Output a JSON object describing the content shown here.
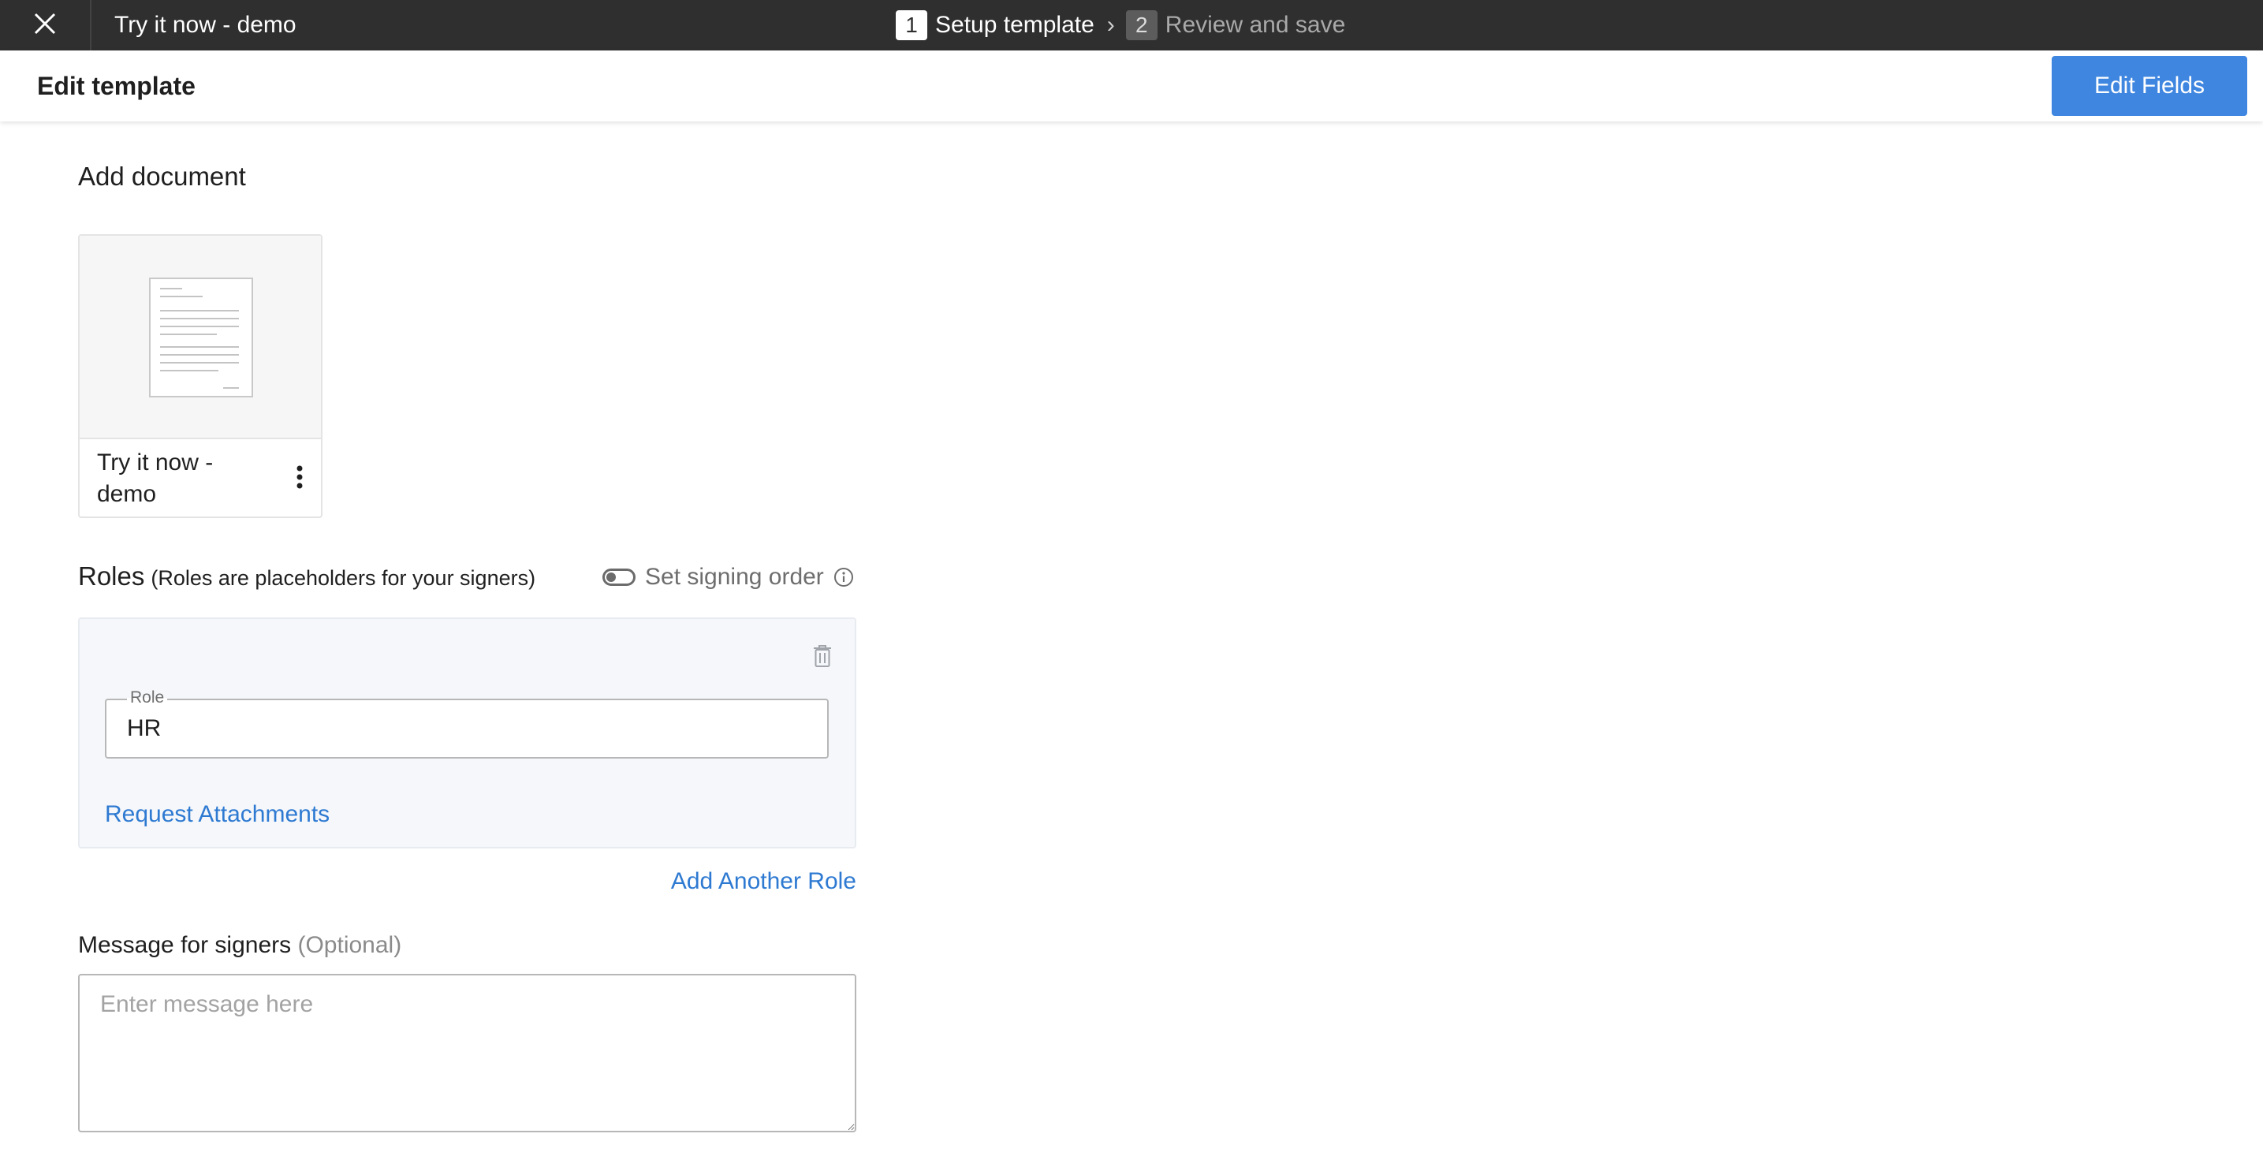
{
  "topbar": {
    "document_title": "Try it now - demo",
    "steps": [
      {
        "number": "1",
        "label": "Setup template"
      },
      {
        "number": "2",
        "label": "Review and save"
      }
    ],
    "step_separator": "›"
  },
  "header": {
    "title": "Edit template",
    "edit_fields_label": "Edit Fields"
  },
  "document_section": {
    "title": "Add document",
    "document_name": "Try it now - demo"
  },
  "roles": {
    "title": "Roles",
    "subtitle": "(Roles are placeholders for your signers)",
    "signing_order_label": "Set signing order",
    "signing_order_enabled": false,
    "items": [
      {
        "field_label": "Role",
        "value": "HR",
        "request_attachments_label": "Request Attachments"
      }
    ],
    "add_role_label": "Add Another Role"
  },
  "message": {
    "label": "Message for signers",
    "optional_label": "(Optional)",
    "placeholder": "Enter message here"
  },
  "icons": {
    "close": "close-icon",
    "kebab": "more-vertical-icon",
    "info": "info-icon",
    "trash": "trash-icon",
    "document": "document-thumbnail"
  },
  "colors": {
    "topbar_bg": "#2f2f2f",
    "primary": "#3f86e0",
    "link": "#2e7ad2",
    "role_card_bg": "#f5f7fa"
  }
}
